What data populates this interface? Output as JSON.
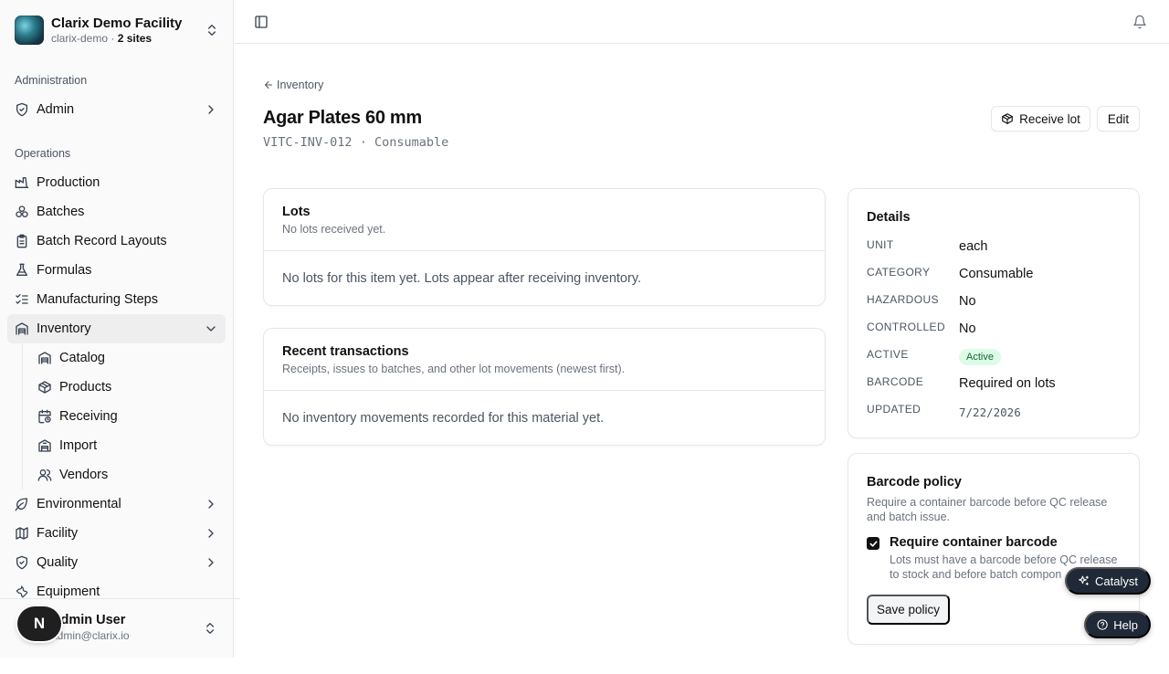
{
  "org": {
    "name": "Clarix Demo Facility",
    "slug": "clarix-demo",
    "sites": "2 sites"
  },
  "sidebar": {
    "admin_label": "Administration",
    "admin_items": [
      {
        "label": "Admin",
        "icon": "shield-icon"
      }
    ],
    "ops_label": "Operations",
    "ops_items": [
      {
        "label": "Production",
        "icon": "factory-icon"
      },
      {
        "label": "Batches",
        "icon": "boxes-icon"
      },
      {
        "label": "Batch Record Layouts",
        "icon": "clipboard-icon"
      },
      {
        "label": "Formulas",
        "icon": "flask-icon"
      },
      {
        "label": "Manufacturing Steps",
        "icon": "list-checks-icon"
      },
      {
        "label": "Inventory",
        "icon": "warehouse-icon",
        "active": true
      },
      {
        "label": "Environmental",
        "icon": "leaf-icon"
      },
      {
        "label": "Facility",
        "icon": "map-icon"
      },
      {
        "label": "Quality",
        "icon": "shield-check-icon"
      },
      {
        "label": "Equipment",
        "icon": "wrench-icon"
      }
    ],
    "inventory_sub": [
      {
        "label": "Catalog",
        "icon": "warehouse-icon"
      },
      {
        "label": "Products",
        "icon": "package-icon"
      },
      {
        "label": "Receiving",
        "icon": "calendar-clock-icon"
      },
      {
        "label": "Import",
        "icon": "building-icon"
      },
      {
        "label": "Vendors",
        "icon": "users-icon"
      }
    ]
  },
  "user": {
    "name": "Admin User",
    "email": "admin@clarix.io",
    "badge": "N"
  },
  "page": {
    "back_label": "Inventory",
    "title": "Agar Plates 60 mm",
    "code": "VITC-INV-012",
    "separator": "·",
    "type": "Consumable",
    "receive_button": "Receive lot",
    "edit_button": "Edit"
  },
  "lots": {
    "title": "Lots",
    "desc": "No lots received yet.",
    "empty": "No lots for this item yet. Lots appear after receiving inventory."
  },
  "transactions": {
    "title": "Recent transactions",
    "desc": "Receipts, issues to batches, and other lot movements (newest first).",
    "empty": "No inventory movements recorded for this material yet."
  },
  "details": {
    "title": "Details",
    "rows": [
      {
        "key": "UNIT",
        "value": "each"
      },
      {
        "key": "CATEGORY",
        "value": "Consumable"
      },
      {
        "key": "HAZARDOUS",
        "value": "No"
      },
      {
        "key": "CONTROLLED",
        "value": "No"
      },
      {
        "key": "ACTIVE",
        "value": "Active"
      },
      {
        "key": "BARCODE",
        "value": "Required on lots"
      },
      {
        "key": "UPDATED",
        "value": "7/22/2026"
      }
    ],
    "active_color": "#dcfce7"
  },
  "barcode_policy": {
    "title": "Barcode policy",
    "desc": "Require a container barcode before QC release and batch issue.",
    "checkbox_label": "Require container barcode",
    "checkbox_checked": true,
    "checkbox_desc": "Lots must have a barcode before QC release to stock and before batch compon",
    "save_button": "Save policy"
  },
  "floating": {
    "catalyst": "Catalyst",
    "help": "Help"
  }
}
